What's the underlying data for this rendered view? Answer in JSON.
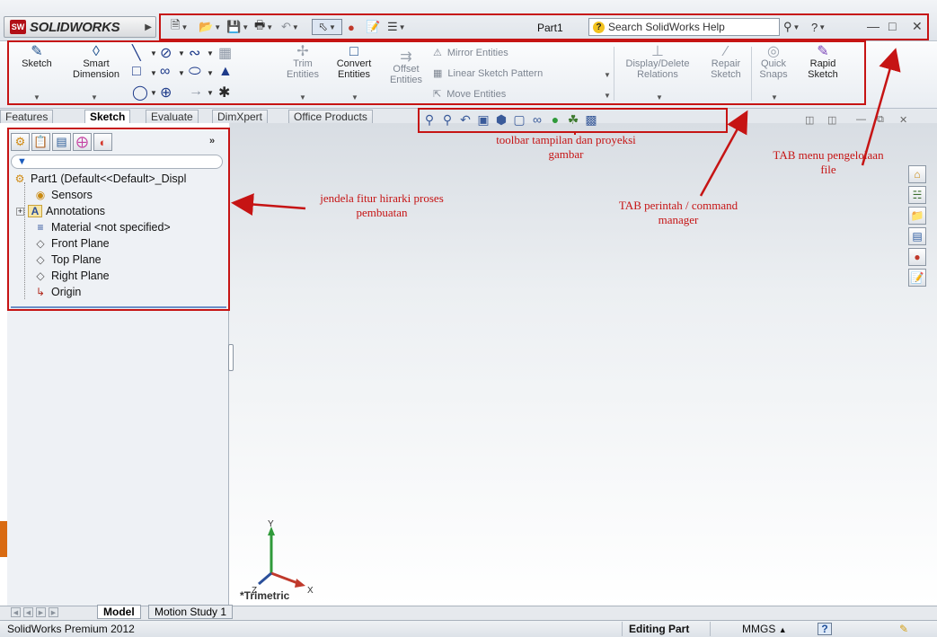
{
  "app": {
    "logo_text": "SOLIDWORKS",
    "logo_badge": "SW",
    "document_title": "Part1",
    "search_placeholder": "Search SolidWorks Help"
  },
  "ribbon": {
    "sketch": "Sketch",
    "smart_dimension": "Smart Dimension",
    "trim_entities": "Trim Entities",
    "convert_entities": "Convert Entities",
    "offset_entities": "Offset Entities",
    "mirror_entities": "Mirror Entities",
    "linear_sketch_pattern": "Linear Sketch Pattern",
    "move_entities": "Move Entities",
    "display_delete_relations": "Display/Delete Relations",
    "repair_sketch": "Repair Sketch",
    "quick_snaps": "Quick Snaps",
    "rapid_sketch": "Rapid Sketch"
  },
  "tabs": [
    "Features",
    "Sketch",
    "Evaluate",
    "DimXpert",
    "Office Products"
  ],
  "active_tab": "Sketch",
  "feature_tree": {
    "root": "Part1  (Default<<Default>_Displ",
    "items": [
      "Sensors",
      "Annotations",
      "Material <not specified>",
      "Front Plane",
      "Top Plane",
      "Right Plane",
      "Origin"
    ],
    "more": "»"
  },
  "annotations": {
    "toolbar_view": "toolbar tampilan dan proyeksi gambar",
    "tab_menu": "TAB menu pengelolaan file",
    "feature_window": "jendela fitur hirarki proses pembuatan",
    "command_manager": "TAB perintah / command manager"
  },
  "graphics": {
    "view_label": "*Trimetric",
    "axis_x": "X",
    "axis_y": "Y",
    "axis_z": "Z"
  },
  "bottom_tabs": [
    "Model",
    "Motion Study 1"
  ],
  "status": {
    "product": "SolidWorks Premium 2012",
    "mode": "Editing Part",
    "units": "MMGS",
    "help": "?"
  },
  "colors": {
    "annotation_red": "#c61414",
    "tree_selection_blue": "#6b8fc7"
  }
}
